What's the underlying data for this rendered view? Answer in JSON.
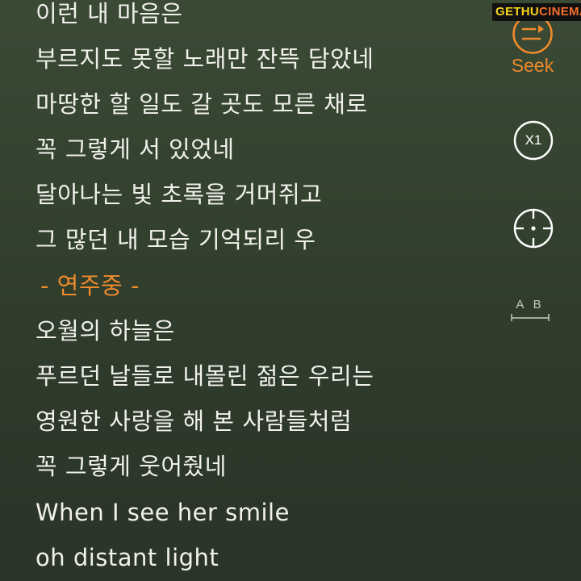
{
  "lyrics": [
    {
      "text": "이런 내 마음은",
      "type": "lyric"
    },
    {
      "text": "부르지도 못할 노래만 잔뜩 담았네",
      "type": "lyric"
    },
    {
      "text": "마땅한 할 일도 갈 곳도 모른 채로",
      "type": "lyric"
    },
    {
      "text": "꼭 그렇게 서 있었네",
      "type": "lyric"
    },
    {
      "text": "달아나는 빛 초록을 거머쥐고",
      "type": "lyric"
    },
    {
      "text": "그 많던 내 모습 기억되리 우",
      "type": "lyric"
    },
    {
      "text": "- 연주중 -",
      "type": "interlude"
    },
    {
      "text": "오월의 하늘은",
      "type": "lyric"
    },
    {
      "text": "푸르던 날들로 내몰린 젊은 우리는",
      "type": "lyric"
    },
    {
      "text": "영원한 사랑을 해 본 사람들처럼",
      "type": "lyric"
    },
    {
      "text": "꼭 그렇게 웃어줬네",
      "type": "lyric"
    },
    {
      "text": "When I see her smile",
      "type": "lyric"
    },
    {
      "text": "oh distant light",
      "type": "lyric"
    }
  ],
  "controls": {
    "seek_label": "Seek",
    "speed_label": "X1",
    "ab_label": "A B"
  },
  "watermark": {
    "part1": "GETHU",
    "part2": "CINEMA"
  },
  "colors": {
    "accent": "#ee8a2c",
    "text": "#f1f1ec",
    "background": "#34432f",
    "icon": "#ffffff"
  },
  "icons": [
    "seek-icon",
    "target-icon",
    "ab-repeat-icon"
  ]
}
